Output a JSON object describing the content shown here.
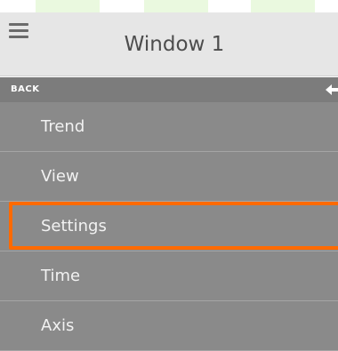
{
  "window": {
    "title": "Window 1"
  },
  "back_bar": {
    "label": "BACK"
  },
  "menu": {
    "items": [
      {
        "label": "Trend"
      },
      {
        "label": "View"
      },
      {
        "label": "Settings"
      },
      {
        "label": "Time"
      },
      {
        "label": "Axis"
      }
    ],
    "selected_label": "Settings"
  },
  "colors": {
    "header_bg": "#e6e6e6",
    "back_bar_bg": "#7c7c7c",
    "menu_bg": "#8a8a8a",
    "highlight": "#ff6a00",
    "top_strip_accent": "#eaf9df"
  },
  "icons": {
    "menu": "hamburger-menu-icon",
    "back": "arrow-left-icon"
  }
}
